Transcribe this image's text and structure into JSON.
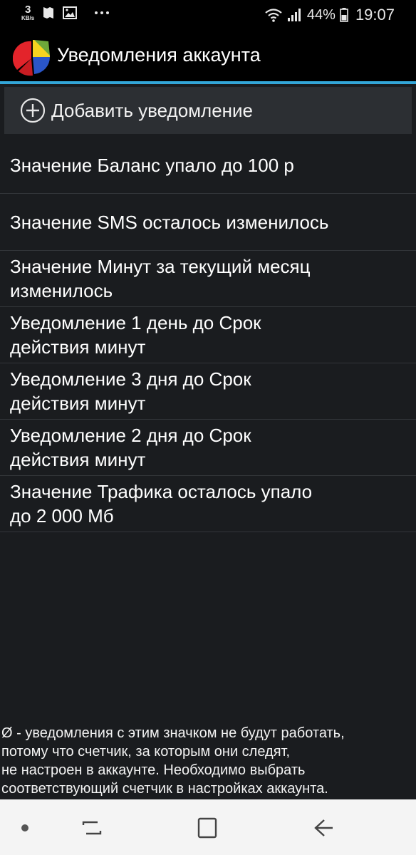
{
  "status_bar": {
    "speed_value": "3",
    "speed_unit": "KB/s",
    "battery_pct": "44%",
    "time": "19:07",
    "icons": [
      "sim-icon",
      "image-icon",
      "more-dots-icon",
      "wifi-icon",
      "signal-icon",
      "battery-icon"
    ]
  },
  "app_bar": {
    "title": "Уведомления аккаунта",
    "accent_color": "#33a6d8"
  },
  "add_button": {
    "label": "Добавить уведомление"
  },
  "notifications": [
    {
      "line1": "Значение Баланс упало до 100 р",
      "line2": ""
    },
    {
      "line1": "Значение SMS осталось изменилось",
      "line2": ""
    },
    {
      "line1": "Значение Минут за текущий месяц",
      "line2": "изменилось"
    },
    {
      "line1": "Уведомление 1 день до Срок",
      "line2": "действия минут"
    },
    {
      "line1": "Уведомление 3 дня до Срок",
      "line2": "действия минут"
    },
    {
      "line1": "Уведомление 2 дня до Срок",
      "line2": "действия минут"
    },
    {
      "line1": "Значение Трафика осталось упало",
      "line2": "до 2 000 Мб"
    }
  ],
  "footer_note": {
    "line1": "Ø - уведомления с этим значком не будут работать,",
    "line2": "потому что счетчик, за которым они следят,",
    "line3": "не настроен в аккаунте. Необходимо выбрать",
    "line4": "соответствующий счетчик в настройках аккаунта."
  }
}
